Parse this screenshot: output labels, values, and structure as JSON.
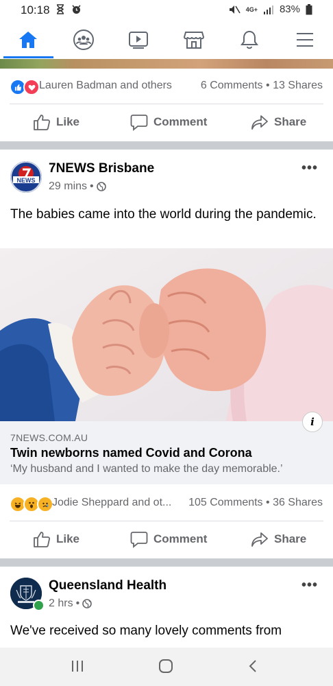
{
  "status_bar": {
    "time": "10:18",
    "network": "4G+",
    "battery": "83%"
  },
  "nav": {
    "items": [
      "home-icon",
      "groups-icon",
      "watch-icon",
      "marketplace-icon",
      "notifications-icon",
      "menu-icon"
    ],
    "active": "home-icon",
    "accent": "#1877f2"
  },
  "prev_post": {
    "reaction_names": "Lauren Badman and others",
    "comments": "6 Comments",
    "shares": "13 Shares"
  },
  "actions": {
    "like": "Like",
    "comment": "Comment",
    "share": "Share"
  },
  "post1": {
    "page_name": "7NEWS Brisbane",
    "avatar_text": "NEWS",
    "time": "29 mins",
    "text": "The babies came into the world during the pandemic.",
    "link": {
      "domain": "7NEWS.COM.AU",
      "title": "Twin newborns named Covid and Corona",
      "description": "‘My husband and I wanted to make the day memorable.’"
    },
    "reaction_names": "Jodie Sheppard and ot...",
    "comments": "105 Comments",
    "shares": "36 Shares"
  },
  "post2": {
    "page_name": "Queensland Health",
    "time": "2 hrs",
    "text": "We've received so many lovely comments from"
  }
}
